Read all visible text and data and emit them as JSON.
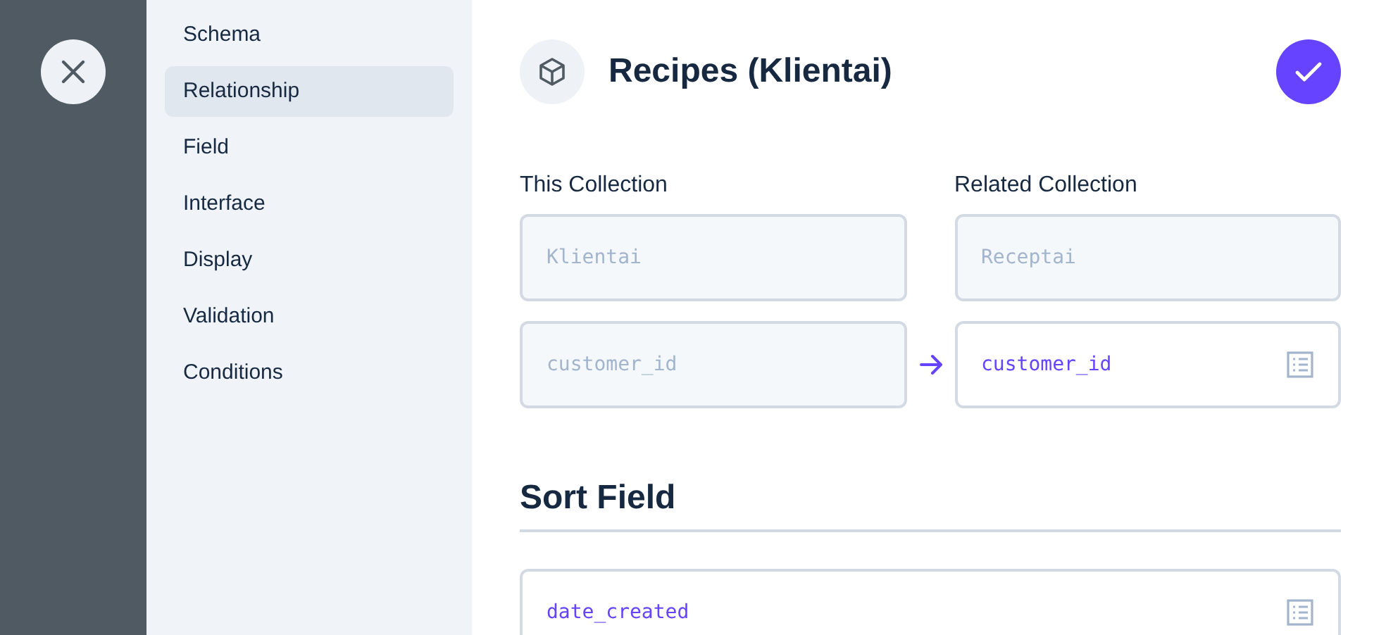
{
  "nav": {
    "items": [
      {
        "label": "Schema",
        "selected": false
      },
      {
        "label": "Relationship",
        "selected": true
      },
      {
        "label": "Field",
        "selected": false
      },
      {
        "label": "Interface",
        "selected": false
      },
      {
        "label": "Display",
        "selected": false
      },
      {
        "label": "Validation",
        "selected": false
      },
      {
        "label": "Conditions",
        "selected": false
      }
    ]
  },
  "header": {
    "title": "Recipes (Klientai)"
  },
  "relationship": {
    "this_label": "This Collection",
    "related_label": "Related Collection",
    "this_collection": {
      "value": "Klientai",
      "disabled": true
    },
    "related_collection": {
      "value": "Receptai",
      "disabled": true
    },
    "this_field": {
      "value": "customer_id",
      "disabled": true
    },
    "related_field": {
      "value": "customer_id",
      "disabled": false
    }
  },
  "sort": {
    "heading": "Sort Field",
    "field": {
      "value": "date_created",
      "disabled": false
    }
  }
}
